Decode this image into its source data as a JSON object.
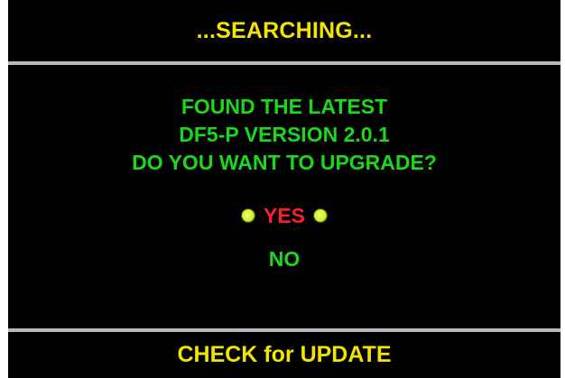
{
  "header": {
    "status_text": "...SEARCHING..."
  },
  "message": {
    "lines": [
      "FOUND THE LATEST",
      "DF5-P VERSION 2.0.1",
      "DO YOU WANT TO UPGRADE?"
    ]
  },
  "options": {
    "yes_label": "YES",
    "no_label": "NO",
    "selected": "YES",
    "selection_marker_icon": "selection-dot-icon"
  },
  "footer": {
    "title": "CHECK for UPDATE"
  },
  "colors": {
    "background": "#000000",
    "header_text": "#f2e400",
    "message_text": "#1bd81b",
    "selected_option": "#ff1f2a",
    "unselected_option": "#1bd81b",
    "divider": "#b8b8b8",
    "selection_marker": "#d8ec2c"
  }
}
